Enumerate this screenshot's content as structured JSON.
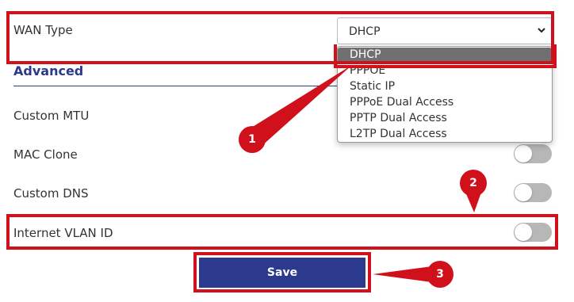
{
  "wan": {
    "label": "WAN Type",
    "selected_value": "DHCP",
    "options": [
      "DHCP",
      "PPPOE",
      "Static IP",
      "PPPoE Dual Access",
      "PPTP Dual Access",
      "L2TP Dual Access"
    ]
  },
  "advanced": {
    "title": "Advanced",
    "rows": [
      {
        "label": "Custom MTU"
      },
      {
        "label": "MAC Clone",
        "toggle_on": false
      },
      {
        "label": "Custom DNS",
        "toggle_on": false
      },
      {
        "label": "Internet VLAN ID",
        "toggle_on": false
      }
    ]
  },
  "save_label": "Save",
  "annotations": [
    "1",
    "2",
    "3"
  ],
  "colors": {
    "accent": "#2b3a8c",
    "callout": "#d0101a",
    "toggle_off": "#b7b7b7",
    "option_highlight": "#707070"
  }
}
